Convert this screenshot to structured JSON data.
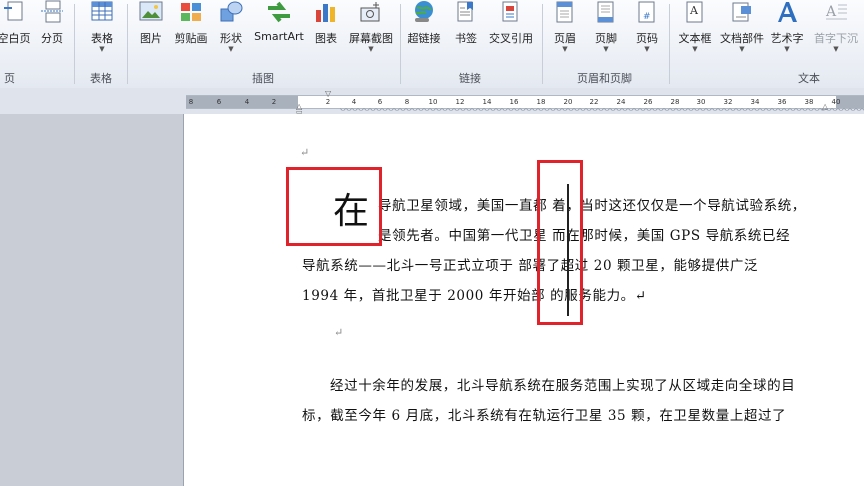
{
  "ribbon": {
    "buttons": [
      {
        "label": "空白页",
        "icon": "blank-page-icon",
        "arrow": false
      },
      {
        "label": "分页",
        "icon": "page-break-icon",
        "arrow": false
      },
      {
        "label": "表格",
        "icon": "table-icon",
        "arrow": true
      },
      {
        "label": "图片",
        "icon": "picture-icon",
        "arrow": false
      },
      {
        "label": "剪贴画",
        "icon": "clip-art-icon",
        "arrow": false
      },
      {
        "label": "形状",
        "icon": "shapes-icon",
        "arrow": true
      },
      {
        "label": "SmartArt",
        "icon": "smartart-icon",
        "arrow": false
      },
      {
        "label": "图表",
        "icon": "chart-icon",
        "arrow": false
      },
      {
        "label": "屏幕截图",
        "icon": "screenshot-icon",
        "arrow": true
      },
      {
        "label": "超链接",
        "icon": "hyperlink-icon",
        "arrow": false
      },
      {
        "label": "书签",
        "icon": "bookmark-icon",
        "arrow": false
      },
      {
        "label": "交叉引用",
        "icon": "cross-reference-icon",
        "arrow": false
      },
      {
        "label": "页眉",
        "icon": "header-icon",
        "arrow": true
      },
      {
        "label": "页脚",
        "icon": "footer-icon",
        "arrow": true
      },
      {
        "label": "页码",
        "icon": "page-number-icon",
        "arrow": true
      },
      {
        "label": "文本框",
        "icon": "text-box-icon",
        "arrow": true
      },
      {
        "label": "文档部件",
        "icon": "quick-parts-icon",
        "arrow": true
      },
      {
        "label": "艺术字",
        "icon": "wordart-icon",
        "arrow": true
      },
      {
        "label": "首字下沉",
        "icon": "drop-cap-icon",
        "arrow": true
      }
    ],
    "groups": {
      "pages": "页",
      "tables": "表格",
      "illustrations": "插图",
      "links": "链接",
      "header_footer": "页眉和页脚",
      "text": "文本"
    }
  },
  "ruler": {
    "numbers": [
      "8",
      "6",
      "4",
      "2",
      "2",
      "4",
      "6",
      "8",
      "10",
      "12",
      "14",
      "16",
      "18",
      "20",
      "22",
      "24",
      "26",
      "28",
      "30",
      "32",
      "34",
      "36",
      "38",
      "40"
    ]
  },
  "document": {
    "para_mark": "↵",
    "dropcap": "在",
    "lines": [
      "导航卫星领域，美国一直都  着，当时这还仅仅是一个导航试验系统，",
      "是领先者。中国第一代卫星  而在那时候，美国 GPS 导航系统已经",
      "导航系统——北斗一号正式立项于  部署了超过 20 颗卫星，能够提供广泛",
      "1994 年，首批卫星于 2000 年开始部  的服务能力。↵",
      "经过十余年的发展，北斗导航系统在服务范围上实现了从区域走向全球的目",
      "标，截至今年 6 月底，北斗系统有在轨运行卫星 35 颗，在卫星数量上超过了"
    ]
  },
  "colors": {
    "highlight_box": "#e0232b"
  }
}
